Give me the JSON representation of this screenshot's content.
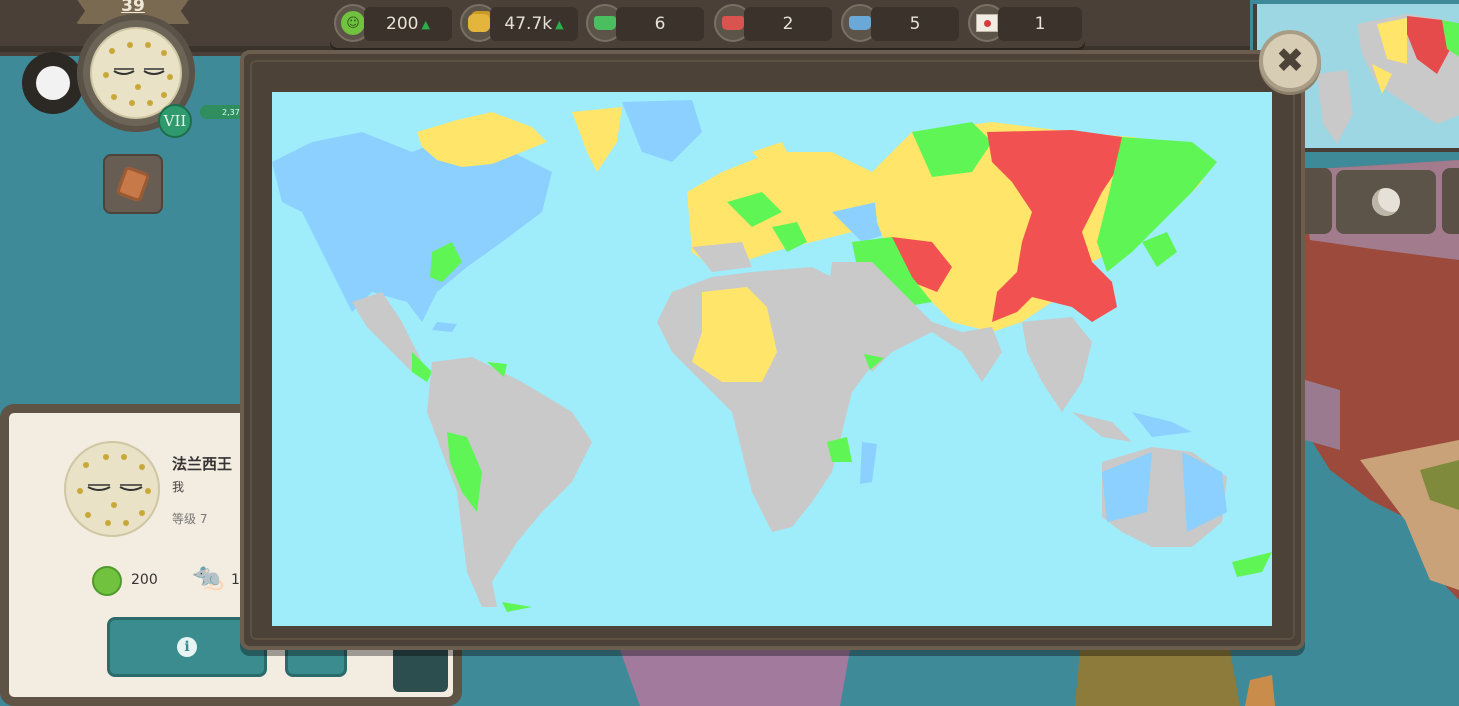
{
  "player": {
    "level": "39",
    "era": "VII",
    "progress_label": "2,37"
  },
  "stats": {
    "happiness": {
      "value": "200",
      "icon": "smiley-icon"
    },
    "gold": {
      "value": "47.7k",
      "icon": "gold-coins-icon"
    },
    "allies": {
      "value": "6",
      "icon": "green-crown-icon"
    },
    "enemies": {
      "value": "2",
      "icon": "red-crown-icon"
    },
    "vassals": {
      "value": "5",
      "icon": "blue-crown-icon"
    },
    "treaties": {
      "value": "1",
      "icon": "treaty-scroll-icon"
    }
  },
  "player_panel": {
    "name": "法兰西王",
    "subtitle": "我",
    "level_label": "等级 7",
    "happiness": "200",
    "rats": "1"
  },
  "modal": {
    "close_icon": "close-icon",
    "legend_colors": {
      "ocean": "#9fecfb",
      "self": "#ffe56a",
      "ally": "#5ff554",
      "enemy": "#f25151",
      "vassal": "#8bd0ff",
      "neutral": "#c9c9c9"
    }
  }
}
